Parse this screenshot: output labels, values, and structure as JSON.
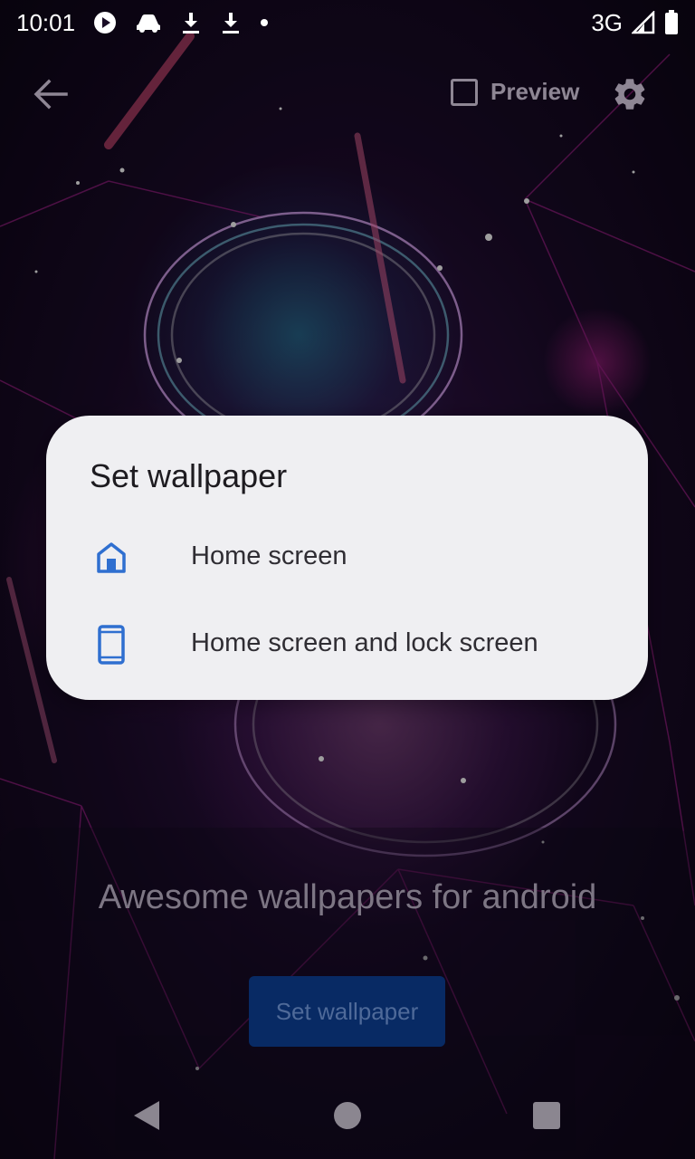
{
  "status_bar": {
    "time": "10:01",
    "network": "3G",
    "icons": [
      "play-icon",
      "car-icon",
      "download-icon",
      "download-icon",
      "dot-icon",
      "signal-icon",
      "battery-icon"
    ]
  },
  "toolbar": {
    "back_icon": "arrow-left-icon",
    "preview_label": "Preview",
    "preview_checked": false,
    "settings_icon": "gear-icon"
  },
  "main": {
    "tagline": "Awesome wallpapers for android",
    "set_wallpaper_label": "Set wallpaper"
  },
  "dialog": {
    "title": "Set wallpaper",
    "options": [
      {
        "label": "Home screen",
        "icon": "home-icon"
      },
      {
        "label": "Home screen and lock screen",
        "icon": "phone-icon"
      }
    ],
    "accent_color": "#2f6fd0"
  },
  "nav_bar": {
    "icons": [
      "nav-back-icon",
      "nav-home-icon",
      "nav-recents-icon"
    ]
  },
  "colors": {
    "dialog_background": "#efeff2",
    "button_background": "#082a64",
    "icon_blue": "#2f6fd0"
  }
}
